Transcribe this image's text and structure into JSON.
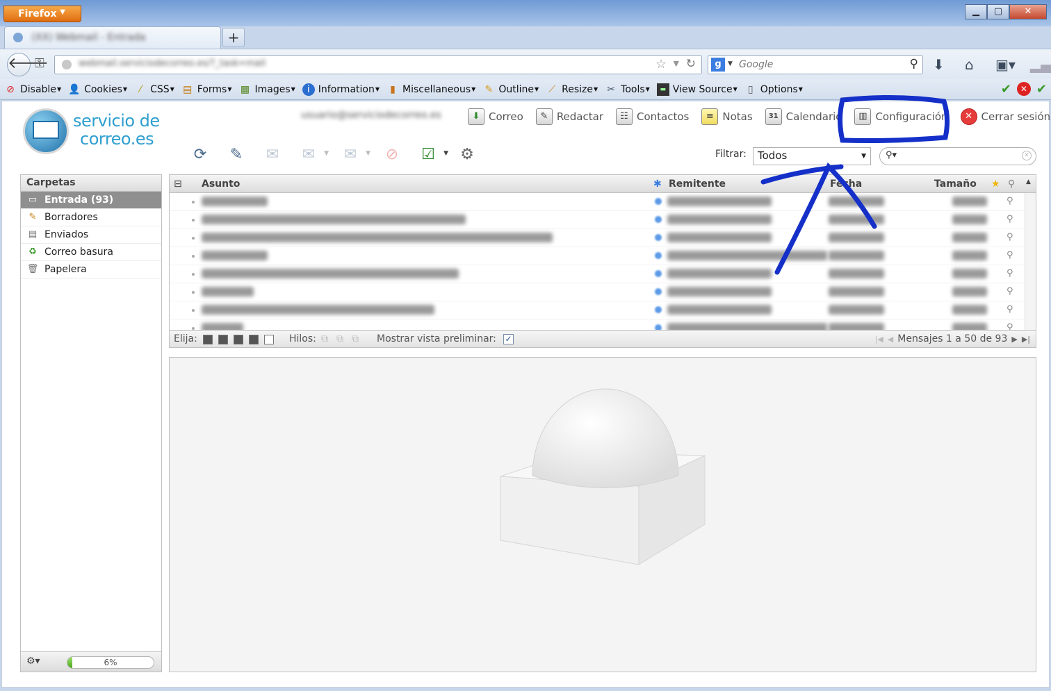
{
  "browser": {
    "menu_label": "Firefox",
    "tab_title": "(XX) Webmail - Entrada",
    "url": "webmail.serviciodecorreo.es/?_task=mail",
    "search_placeholder": "Google"
  },
  "bookmarks": [
    {
      "label": "Disable",
      "icon": "disable-icon"
    },
    {
      "label": "Cookies",
      "icon": "cookies-icon"
    },
    {
      "label": "CSS",
      "icon": "css-wand-icon"
    },
    {
      "label": "Forms",
      "icon": "forms-icon"
    },
    {
      "label": "Images",
      "icon": "images-icon"
    },
    {
      "label": "Information",
      "icon": "info-icon"
    },
    {
      "label": "Miscellaneous",
      "icon": "misc-icon"
    },
    {
      "label": "Outline",
      "icon": "outline-pencil-icon"
    },
    {
      "label": "Resize",
      "icon": "resize-ruler-icon"
    },
    {
      "label": "Tools",
      "icon": "tools-icon"
    },
    {
      "label": "View Source",
      "icon": "view-source-icon"
    },
    {
      "label": "Options",
      "icon": "options-icon"
    }
  ],
  "webmail": {
    "logo_line1": "servicio de",
    "logo_line2": "correo.es",
    "user_email": "usuario@serviciodecorreo.es",
    "nav": [
      {
        "label": "Correo",
        "icon": "mail-icon"
      },
      {
        "label": "Redactar",
        "icon": "compose-icon"
      },
      {
        "label": "Contactos",
        "icon": "contacts-icon"
      },
      {
        "label": "Notas",
        "icon": "notes-icon"
      },
      {
        "label": "Calendario",
        "icon": "calendar-icon"
      },
      {
        "label": "Configuración",
        "icon": "settings-icon"
      },
      {
        "label": "Cerrar sesión",
        "icon": "logout-icon"
      }
    ],
    "filter_label": "Filtrar:",
    "filter_value": "Todos",
    "folders_title": "Carpetas",
    "folders": [
      {
        "label": "Entrada (93)",
        "icon": "inbox-icon",
        "selected": true
      },
      {
        "label": "Borradores",
        "icon": "drafts-icon",
        "selected": false
      },
      {
        "label": "Enviados",
        "icon": "sent-icon",
        "selected": false
      },
      {
        "label": "Correo basura",
        "icon": "junk-icon",
        "selected": false
      },
      {
        "label": "Papelera",
        "icon": "trash-icon",
        "selected": false
      }
    ],
    "quota_percent": 6,
    "quota_text": "6%",
    "list_columns": {
      "subject": "Asunto",
      "from": "Remitente",
      "date": "Fecha",
      "size": "Tamaño"
    },
    "footer": {
      "select_label": "Elija:",
      "threads_label": "Hilos:",
      "preview_label": "Mostrar vista preliminar:",
      "preview_checked": true,
      "count_text": "Mensajes 1 a 50 de 93"
    }
  }
}
